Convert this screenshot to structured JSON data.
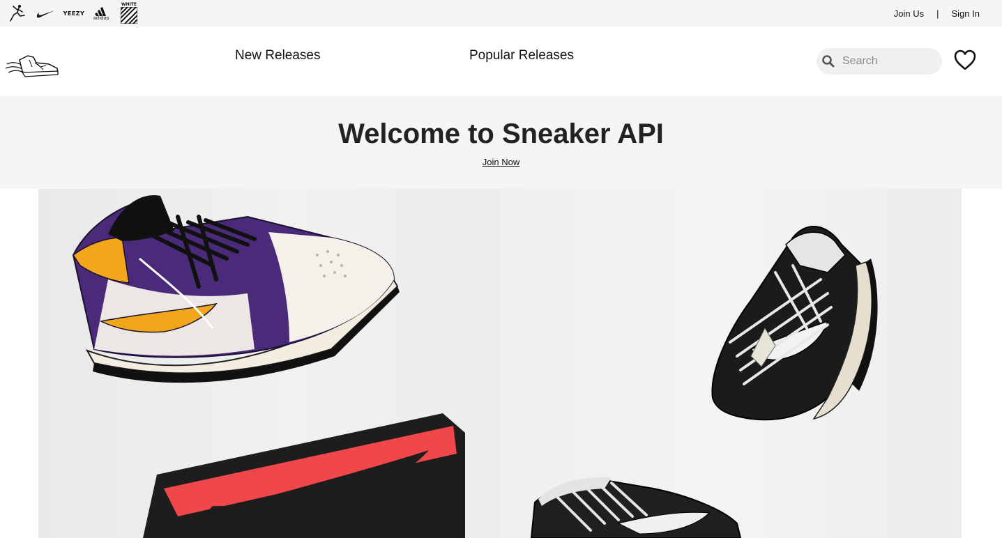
{
  "topbar": {
    "brands": [
      {
        "name": "jordan",
        "icon": "jumpman-icon"
      },
      {
        "name": "nike",
        "icon": "nike-swoosh-icon"
      },
      {
        "name": "yeezy",
        "label": "YEEZY"
      },
      {
        "name": "adidas",
        "label": "adidas"
      },
      {
        "name": "off-white",
        "label": "WHITE"
      }
    ],
    "join_us": "Join Us",
    "separator": "|",
    "sign_in": "Sign In"
  },
  "nav": {
    "new_releases": "New Releases",
    "popular_releases": "Popular Releases",
    "search_placeholder": "Search",
    "search_value": ""
  },
  "hero": {
    "title": "Welcome to Sneaker API",
    "join_now": "Join Now"
  },
  "colors": {
    "topbar_bg": "#f5f5f5",
    "hero_bg": "#f5f5f5",
    "search_bg": "#f0f0f0",
    "text": "#111111",
    "box_red": "#f0484a",
    "purple": "#4b2a7a",
    "gold": "#f2a71b"
  }
}
